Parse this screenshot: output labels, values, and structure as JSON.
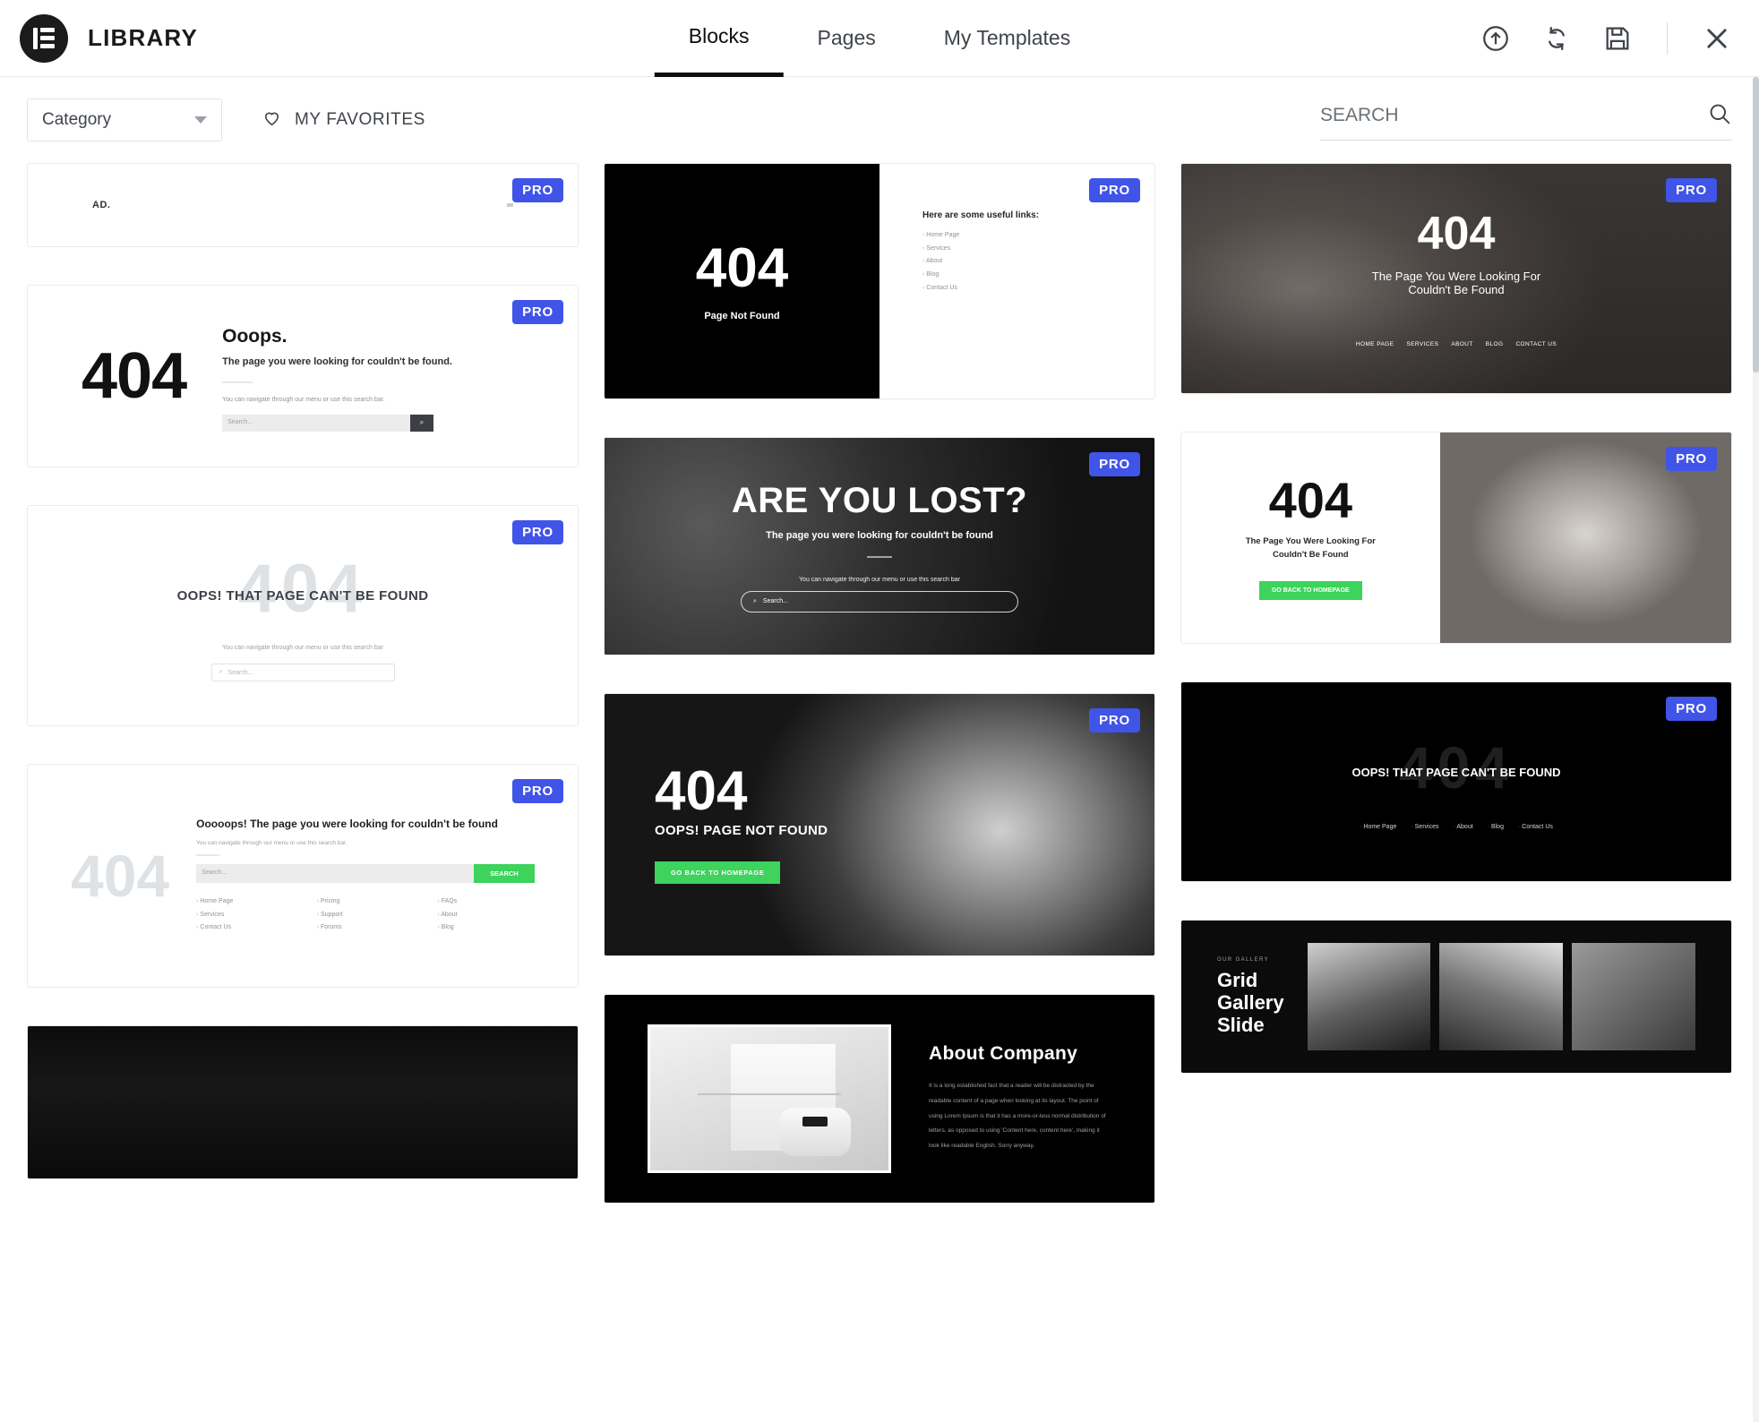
{
  "header": {
    "brand_title": "LIBRARY",
    "tabs": [
      {
        "label": "Blocks",
        "active": true
      },
      {
        "label": "Pages",
        "active": false
      },
      {
        "label": "My Templates",
        "active": false
      }
    ],
    "actions": [
      {
        "name": "upload-icon",
        "title": "Import Template"
      },
      {
        "name": "sync-icon",
        "title": "Sync Library"
      },
      {
        "name": "save-icon",
        "title": "Save"
      },
      {
        "name": "close-icon",
        "title": "Close"
      }
    ]
  },
  "filterbar": {
    "category_label": "Category",
    "favorites_label": "MY FAVORITES",
    "search_placeholder": "SEARCH",
    "search_value": ""
  },
  "colors": {
    "pro_badge": "#4054e8",
    "green_button": "#3dd35c",
    "accent_dark": "#0c0d0e"
  },
  "badges": {
    "pro": "PRO"
  },
  "templates": {
    "ad_header": {
      "logo": "AD."
    },
    "ooops": {
      "number": "404",
      "title": "Ooops.",
      "subtitle": "The page you were looking for couldn't be found.",
      "note": "You can navigate through our menu or use this search bar.",
      "search_placeholder": "Search...",
      "search_button": "Q"
    },
    "oops_light": {
      "ghost": "404",
      "headline": "OOPS! THAT PAGE CAN'T BE FOUND",
      "note": "You can navigate through our menu or use this search bar",
      "search_placeholder": "Search..."
    },
    "ooooops_links": {
      "number": "404",
      "headline": "Ooooops! The page you were looking for couldn't be found",
      "note": "You can navigate through our menu or use this search bar.",
      "search_placeholder": "Search...",
      "search_button": "SEARCH",
      "columns": [
        [
          "Home Page",
          "Services",
          "Contact Us"
        ],
        [
          "Pricing",
          "Support",
          "Forums"
        ],
        [
          "FAQs",
          "About",
          "Blog"
        ]
      ]
    },
    "black_404_links": {
      "number": "404",
      "caption": "Page Not Found",
      "links_heading": "Here are some useful links:",
      "links": [
        "Home Page",
        "Services",
        "About",
        "Blog",
        "Contact Us"
      ]
    },
    "are_you_lost": {
      "title": "ARE YOU LOST?",
      "subtitle": "The page you were looking for couldn't be found",
      "note": "You can navigate through our menu or use this search bar",
      "search_placeholder": "Search..."
    },
    "man_404": {
      "number": "404",
      "caption": "OOPS! PAGE NOT FOUND",
      "button": "GO BACK TO HOMEPAGE"
    },
    "about_company": {
      "title": "About Company",
      "body": "It is a long established fact that a reader will be distracted by the readable content of a page when looking at its layout. The point of using Lorem Ipsum is that it has a more-or-less normal distribution of letters, as opposed to using 'Content here, content here', making it look like readable English. Sorry anyway."
    },
    "keyboard_404": {
      "number": "404",
      "subtitle_line1": "The Page You Were Looking For",
      "subtitle_line2": "Couldn't Be Found",
      "nav": [
        "HOME PAGE",
        "SERVICES",
        "ABOUT",
        "BLOG",
        "CONTACT US"
      ]
    },
    "baby_404": {
      "number": "404",
      "subtitle_line1": "The Page You Were Looking For",
      "subtitle_line2": "Couldn't Be Found",
      "button": "GO BACK TO HOMEPAGE"
    },
    "dark_oops": {
      "ghost": "404",
      "headline": "OOPS! THAT PAGE CAN'T BE FOUND",
      "nav": [
        "Home Page",
        "Services",
        "About",
        "Blog",
        "Contact Us"
      ]
    },
    "grid_gallery": {
      "eyebrow": "OUR GALLERY",
      "title_line1": "Grid",
      "title_line2": "Gallery",
      "title_line3": "Slide"
    }
  }
}
